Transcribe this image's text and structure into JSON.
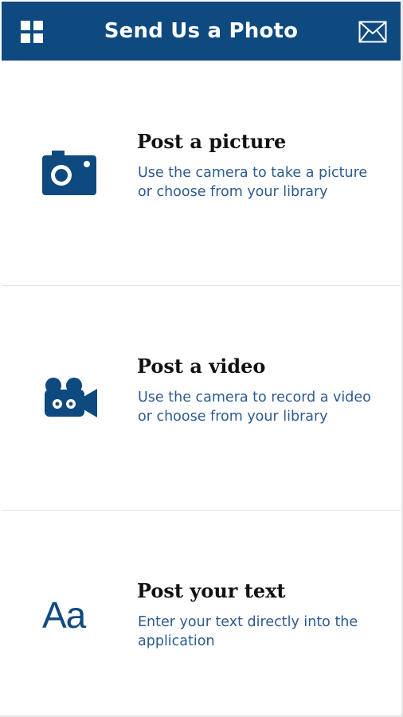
{
  "header": {
    "title": "Send Us a Photo",
    "menu_icon": "grid-menu-icon",
    "mail_icon": "envelope-icon"
  },
  "options": [
    {
      "title": "Post a picture",
      "description": "Use the camera to take a picture or choose from your library",
      "icon": "camera-icon"
    },
    {
      "title": "Post a video",
      "description": "Use the camera to record a video or choose from your library",
      "icon": "video-camera-icon"
    },
    {
      "title": "Post your text",
      "description": "Enter your text directly into the application",
      "icon": "text-icon",
      "icon_text": "Aa"
    }
  ],
  "colors": {
    "primary": "#0e4a80",
    "heading": "#111111",
    "description": "#2c5b8f",
    "divider": "#e4e4e4"
  }
}
